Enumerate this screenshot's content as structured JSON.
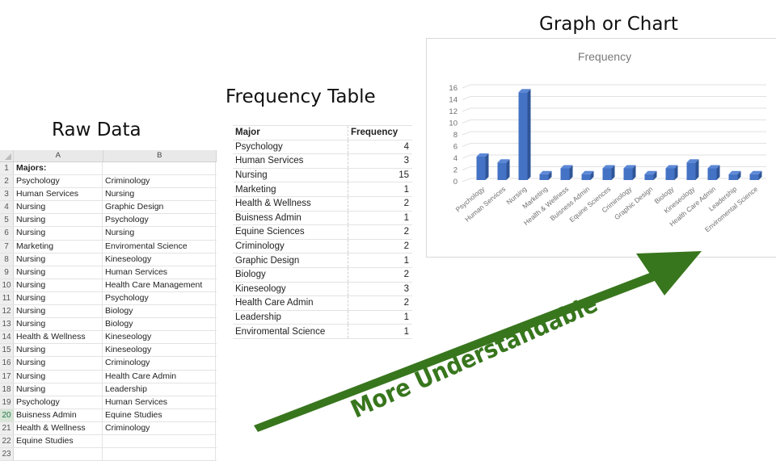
{
  "headings": {
    "raw_data": "Raw Data",
    "frequency_table": "Frequency Table",
    "graph": "Graph or Chart"
  },
  "spreadsheet": {
    "corner": "",
    "columns": [
      "A",
      "B"
    ],
    "rows": [
      {
        "n": "1",
        "a": "Majors:",
        "b": ""
      },
      {
        "n": "2",
        "a": "Psychology",
        "b": "Criminology"
      },
      {
        "n": "3",
        "a": "Human Services",
        "b": "Nursing"
      },
      {
        "n": "4",
        "a": "Nursing",
        "b": "Graphic Design"
      },
      {
        "n": "5",
        "a": "Nursing",
        "b": "Psychology"
      },
      {
        "n": "6",
        "a": "Nursing",
        "b": "Nursing"
      },
      {
        "n": "7",
        "a": "Marketing",
        "b": "Enviromental Science"
      },
      {
        "n": "8",
        "a": "Nursing",
        "b": "Kineseology"
      },
      {
        "n": "9",
        "a": "Nursing",
        "b": "Human Services"
      },
      {
        "n": "10",
        "a": "Nursing",
        "b": "Health Care Management"
      },
      {
        "n": "11",
        "a": "Nursing",
        "b": "Psychology"
      },
      {
        "n": "12",
        "a": "Nursing",
        "b": "Biology"
      },
      {
        "n": "13",
        "a": "Nursing",
        "b": "Biology"
      },
      {
        "n": "14",
        "a": "Health & Wellness",
        "b": "Kineseology"
      },
      {
        "n": "15",
        "a": "Nursing",
        "b": "Kineseology"
      },
      {
        "n": "16",
        "a": "Nursing",
        "b": "Criminology"
      },
      {
        "n": "17",
        "a": "Nursing",
        "b": "Health Care Admin"
      },
      {
        "n": "18",
        "a": "Nursing",
        "b": "Leadership"
      },
      {
        "n": "19",
        "a": "Psychology",
        "b": "Human Services"
      },
      {
        "n": "20",
        "a": "Buisness Admin",
        "b": "Equine Studies"
      },
      {
        "n": "21",
        "a": "Health & Wellness",
        "b": "Criminology"
      },
      {
        "n": "22",
        "a": "Equine Studies",
        "b": ""
      },
      {
        "n": "23",
        "a": "",
        "b": ""
      }
    ],
    "selected_row": "20"
  },
  "frequency_table": {
    "headers": [
      "Major",
      "Frequency"
    ],
    "rows": [
      [
        "Psychology",
        "4"
      ],
      [
        "Human Services",
        "3"
      ],
      [
        "Nursing",
        "15"
      ],
      [
        "Marketing",
        "1"
      ],
      [
        "Health & Wellness",
        "2"
      ],
      [
        "Buisness Admin",
        "1"
      ],
      [
        "Equine Sciences",
        "2"
      ],
      [
        "Criminology",
        "2"
      ],
      [
        "Graphic Design",
        "1"
      ],
      [
        "Biology",
        "2"
      ],
      [
        "Kineseology",
        "3"
      ],
      [
        "Health Care Admin",
        "2"
      ],
      [
        "Leadership",
        "1"
      ],
      [
        "Enviromental Science",
        "1"
      ]
    ]
  },
  "arrow": {
    "label": "More Understandable",
    "color": "#38761d"
  },
  "chart_data": {
    "type": "bar",
    "title": "Frequency",
    "xlabel": "",
    "ylabel": "",
    "categories": [
      "Psychology",
      "Human Services",
      "Nursing",
      "Marketing",
      "Health & Wellness",
      "Buisness Admin",
      "Equine Sciences",
      "Criminology",
      "Graphic Design",
      "Biology",
      "Kineseology",
      "Health Care Admin",
      "Leadership",
      "Enviromental Science"
    ],
    "values": [
      4,
      3,
      15,
      1,
      2,
      1,
      2,
      2,
      1,
      2,
      3,
      2,
      1,
      1
    ],
    "ylim": [
      0,
      16
    ],
    "yticks": [
      "0",
      "2",
      "4",
      "6",
      "8",
      "10",
      "12",
      "14",
      "16"
    ],
    "grid": true,
    "legend": "none",
    "style": "3d-column",
    "bar_color": "#4472c4",
    "bar_side_color": "#2f5597",
    "bar_top_color": "#5b87d6"
  }
}
